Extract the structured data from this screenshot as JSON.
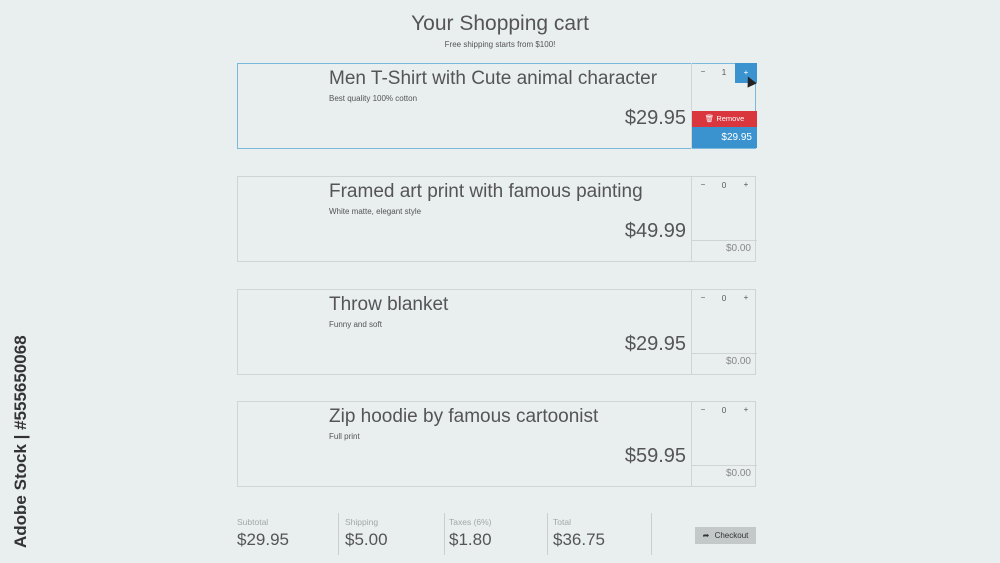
{
  "header": {
    "title": "Your Shopping cart",
    "subtitle": "Free shipping starts from $100!"
  },
  "items": [
    {
      "name": "Men T-Shirt with Cute animal character",
      "description": "Best quality 100% cotton",
      "price": "$29.95",
      "quantity": "1",
      "subtotal": "$29.95",
      "remove_label": "Remove",
      "active": true
    },
    {
      "name": "Framed art print with famous painting",
      "description": "White matte, elegant style",
      "price": "$49.99",
      "quantity": "0",
      "subtotal": "$0.00"
    },
    {
      "name": "Throw blanket",
      "description": "Funny and soft",
      "price": "$29.95",
      "quantity": "0",
      "subtotal": "$0.00"
    },
    {
      "name": "Zip hoodie by famous cartoonist",
      "description": "Full print",
      "price": "$59.95",
      "quantity": "0",
      "subtotal": "$0.00"
    }
  ],
  "stepper": {
    "minus": "−",
    "plus": "+"
  },
  "summary": {
    "subtotal": {
      "label": "Subtotal",
      "value": "$29.95"
    },
    "shipping": {
      "label": "Shipping",
      "value": "$5.00"
    },
    "taxes": {
      "label": "Taxes (6%)",
      "value": "$1.80"
    },
    "total": {
      "label": "Total",
      "value": "$36.75"
    },
    "checkout_label": "Checkout"
  },
  "watermark": "Adobe Stock | #555650068",
  "colors": {
    "accent": "#3a93cf",
    "danger": "#d9363e",
    "background": "#e9eeee"
  }
}
